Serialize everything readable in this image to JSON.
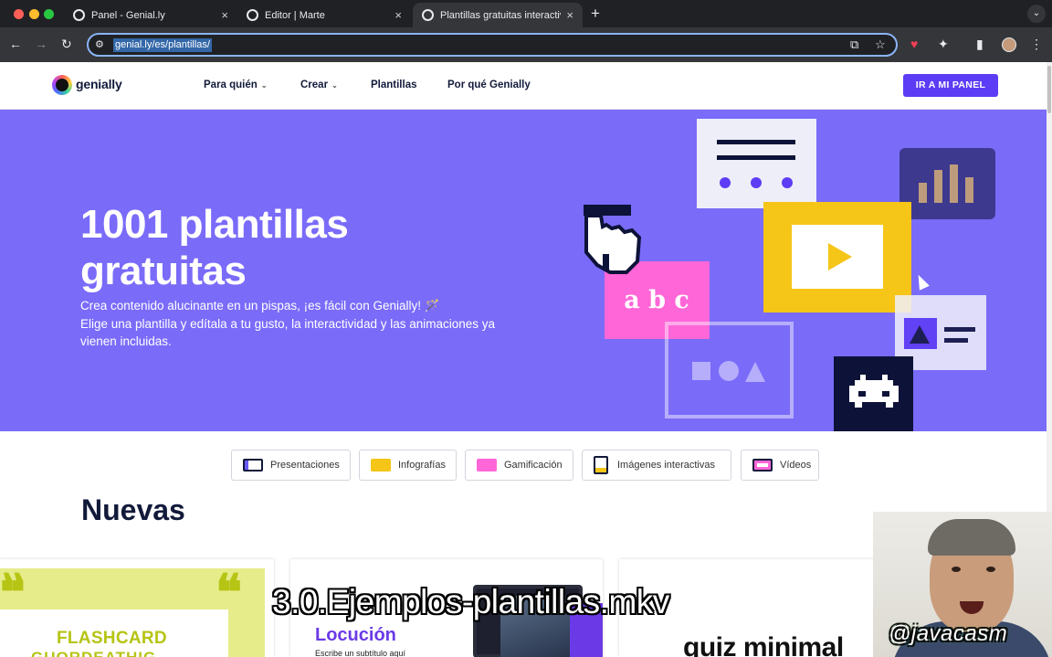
{
  "browser": {
    "tabs": [
      {
        "title": "Panel - Genial.ly",
        "close": "×"
      },
      {
        "title": "Editor | Marte",
        "close": "×"
      },
      {
        "title": "Plantillas gratuitas interactiva",
        "close": "×"
      }
    ],
    "new_tab": "+",
    "tab_menu": "⌄",
    "url": "genial.ly/es/plantillas/",
    "nav": {
      "back": "←",
      "forward": "→",
      "reload": "↻"
    },
    "omnibox_icons": {
      "tune": "⚙",
      "install": "⧉",
      "bookmark": "☆"
    },
    "ext_icons": {
      "pocket": "♥",
      "extensions": "✦",
      "sidepanel": "▮",
      "menu": "⋮"
    }
  },
  "header": {
    "logo": "genially",
    "nav": [
      {
        "label": "Para quién",
        "has_dropdown": true
      },
      {
        "label": "Crear",
        "has_dropdown": true
      },
      {
        "label": "Plantillas",
        "has_dropdown": false
      },
      {
        "label": "Por qué Genially",
        "has_dropdown": false
      }
    ],
    "chevron": "⌄",
    "cta": "IR A MI PANEL"
  },
  "hero": {
    "title": "1001 plantillas gratuitas",
    "subtitle_line1": "Crea contenido alucinante en un pispas, ¡es fácil con Genially! 🪄",
    "subtitle_line2": "Elige una plantilla y edítala a tu gusto, la interactividad y las animaciones ya vienen incluidas.",
    "card_abc": "a b c",
    "colors": {
      "background": "#7a6bf9",
      "yellow": "#f5c518",
      "pink": "#ff66d8",
      "navy": "#0d1238"
    }
  },
  "categories": [
    {
      "label": "Presentaciones",
      "icon": "presentation-icon",
      "color": "#6a5af9"
    },
    {
      "label": "Infografías",
      "icon": "infographic-icon",
      "color": "#f5c518"
    },
    {
      "label": "Gamificación",
      "icon": "gamepad-icon",
      "color": "#ff66d8"
    },
    {
      "label": "Imágenes interactivas",
      "icon": "image-icon",
      "color": "#f5c518"
    },
    {
      "label": "Vídeos",
      "icon": "video-icon",
      "color": "#ff66d8"
    }
  ],
  "section": {
    "title": "Nuevas"
  },
  "templates": [
    {
      "title": "FLASHCARD",
      "subtitle": "GUORDEATHIG",
      "quote": "❝"
    },
    {
      "title": "Locución",
      "subtitle": "Escribe un subtítulo aquí"
    },
    {
      "title": "quiz minimal"
    }
  ],
  "overlay": {
    "watermark": "3.0.Ejemplos-plantillas.mkv",
    "handle": "@javacasm"
  }
}
